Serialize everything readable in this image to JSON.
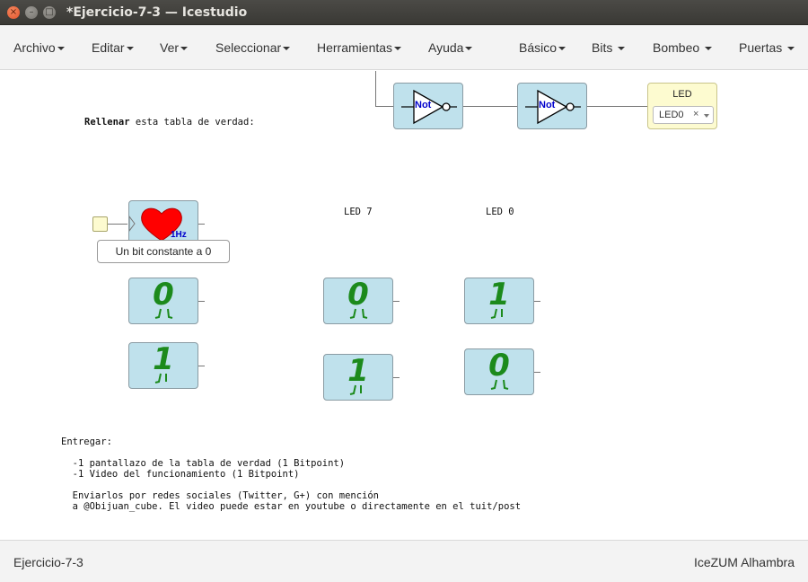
{
  "window": {
    "title": "*Ejercicio-7-3 — Icestudio"
  },
  "menu_left": [
    "Archivo",
    "Editar",
    "Ver",
    "Seleccionar",
    "Herramientas",
    "Ayuda"
  ],
  "menu_right": [
    "Básico",
    "Bits",
    "Bombeo",
    "Puertas"
  ],
  "canvas": {
    "instruction_bold": "Rellenar",
    "instruction_rest": " esta tabla de verdad:",
    "not_label": "Not",
    "led_block": {
      "title": "LED",
      "selected": "LED0",
      "clear": "×"
    },
    "clock_label": "1Hz",
    "tooltip": "Un bit constante a 0",
    "col_led7": "LED 7",
    "col_led0": "LED 0",
    "bits": {
      "left_a": "0",
      "left_b": "1",
      "mid_a": "0",
      "mid_b": "1",
      "right_a": "1",
      "right_b": "0"
    },
    "deliver_title": "Entregar:",
    "deliver_line1": "  -1 pantallazo de la tabla de verdad (1 Bitpoint)",
    "deliver_line2": "  -1 Video del funcionamiento (1 Bitpoint)",
    "deliver_line3": "  Enviarlos por redes sociales (Twitter, G+) con mención",
    "deliver_line4": "  a @Obijuan_cube. El video puede estar en youtube o directamente en el tuit/post"
  },
  "footer": {
    "project": "Ejercicio-7-3",
    "board": "IceZUM Alhambra"
  },
  "colors": {
    "block_fill": "#bfe1ec",
    "led_fill": "#fdfbd0",
    "bit_green": "#1c8a1c",
    "heart_red": "#ff0000",
    "not_blue": "#0000cc"
  }
}
